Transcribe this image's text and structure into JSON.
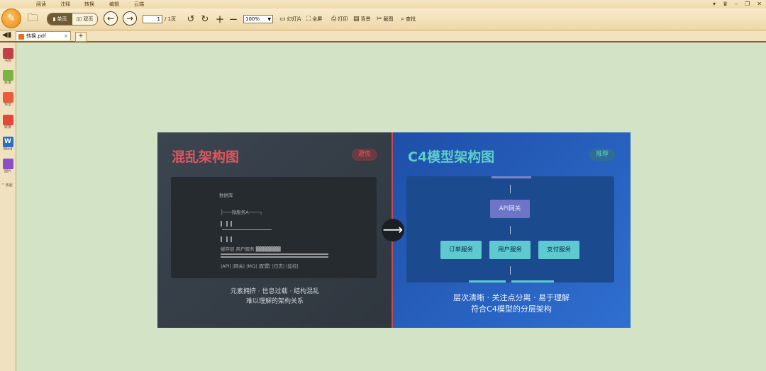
{
  "menu": [
    "阅读",
    "注释",
    "转换",
    "编辑",
    "云端"
  ],
  "toolbar": {
    "single_page": "单页",
    "double_page": "双页",
    "page_current": "1",
    "page_total": "/ 1页",
    "zoom": "100%",
    "tools": {
      "slideshow": "幻灯片",
      "fullscreen": "全屏",
      "print": "打印",
      "background": "背景",
      "screenshot": "截图",
      "find": "查找"
    }
  },
  "tab": {
    "title": "转换.pdf"
  },
  "sidebar": {
    "items": [
      "书签",
      "目录",
      "预览",
      "转换",
      "Word",
      "图片"
    ],
    "more": "^ 收起"
  },
  "document": {
    "left": {
      "title": "混乱架构图",
      "badge": "避免",
      "chaos_lines": [
        "数据库",
        "├───微服务A────┐",
        "缓存层 用户服务 ▓▓▓▓▓▓▓",
        "|API| |网关| |MQ| |配置| |日志| |监控|"
      ],
      "caption_line1": "元素拥挤 · 信息过载 · 结构混乱",
      "caption_line2": "难以理解的架构关系"
    },
    "right": {
      "title": "C4模型架构图",
      "badge": "推荐",
      "gateway": "API网关",
      "services": [
        "订单服务",
        "用户服务",
        "支付服务"
      ],
      "caption_line1": "层次清晰 · 关注点分离 · 易于理解",
      "caption_line2": "符合C4模型的分层架构"
    },
    "arrow": "⟶"
  }
}
